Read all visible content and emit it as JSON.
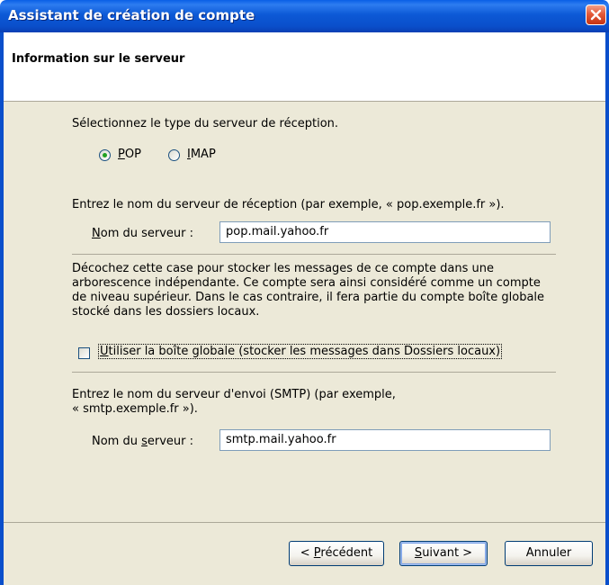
{
  "window": {
    "title": "Assistant de création de compte"
  },
  "header": {
    "title": "Information sur le serveur"
  },
  "incoming": {
    "prompt": "Sélectionnez le type du serveur de réception.",
    "options": [
      {
        "label_hot": "P",
        "label_rest": "OP",
        "selected": true
      },
      {
        "label_hot": "I",
        "label_rest": "MAP",
        "selected": false
      }
    ],
    "hint": "Entrez le nom du serveur de réception (par exemple, « pop.exemple.fr »).",
    "label_pre": "",
    "label_hot": "N",
    "label_post": "om du serveur :",
    "value": "pop.mail.yahoo.fr"
  },
  "global_inbox": {
    "description": "Décochez cette case pour stocker les messages de ce compte dans une arborescence indépendante. Ce compte sera ainsi considéré comme un compte de niveau supérieur. Dans le cas contraire, il fera partie du compte boîte globale stocké dans les dossiers locaux.",
    "checkbox_hot": "U",
    "checkbox_rest": "tiliser la boîte globale (stocker les messages dans Dossiers locaux)",
    "checked": false
  },
  "outgoing": {
    "hint_line1": "Entrez le nom du serveur d'envoi (SMTP) (par exemple,",
    "hint_line2": "« smtp.exemple.fr »).",
    "label_pre": "Nom du ",
    "label_hot": "s",
    "label_post": "erveur :",
    "value": "smtp.mail.yahoo.fr"
  },
  "buttons": {
    "back_pre": "< ",
    "back_hot": "P",
    "back_post": "récédent",
    "next_hot": "S",
    "next_post": "uivant >",
    "cancel": "Annuler"
  },
  "colors": {
    "titlebar": "#0a4fcb",
    "dialog_bg": "#ece9d8",
    "radio_dot": "#21a121",
    "close_button": "#e45a3a"
  }
}
